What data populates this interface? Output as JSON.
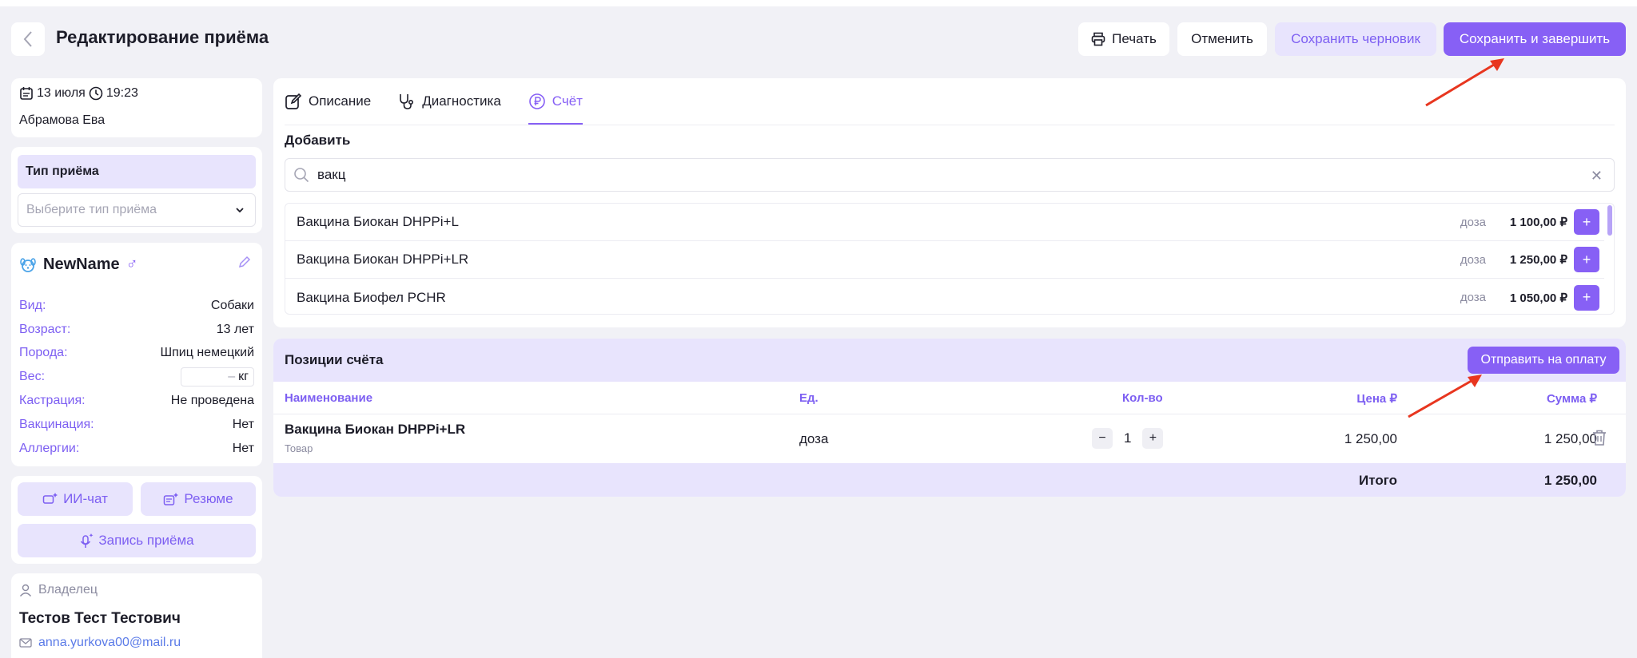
{
  "header": {
    "title": "Редактирование приёма",
    "print_label": "Печать",
    "cancel_label": "Отменить",
    "draft_label": "Сохранить черновик",
    "save_label": "Сохранить и завершить"
  },
  "visit": {
    "date": "13 июля",
    "time": "19:23",
    "doctor": "Абрамова Ева"
  },
  "visit_type": {
    "label": "Тип приёма",
    "placeholder": "Выберите тип приёма"
  },
  "pet": {
    "name": "NewName",
    "sex_symbol": "♂",
    "fields": [
      {
        "key": "Вид:",
        "value": "Собаки"
      },
      {
        "key": "Возраст:",
        "value": "13 лет"
      },
      {
        "key": "Порода:",
        "value": "Шпиц немецкий"
      },
      {
        "key": "Вес:",
        "value": "–",
        "unit": "кг"
      },
      {
        "key": "Кастрация:",
        "value": "Не проведена"
      },
      {
        "key": "Вакцинация:",
        "value": "Нет"
      },
      {
        "key": "Аллергии:",
        "value": "Нет"
      }
    ]
  },
  "ai": {
    "chat_label": "ИИ-чат",
    "resume_label": "Резюме",
    "record_label": "Запись приёма"
  },
  "owner": {
    "label": "Владелец",
    "name": "Тестов Тест Тестович",
    "email": "anna.yurkova00@mail.ru"
  },
  "tabs": [
    {
      "label": "Описание",
      "icon": "edit-icon"
    },
    {
      "label": "Диагностика",
      "icon": "stethoscope-icon"
    },
    {
      "label": "Счёт",
      "icon": "ruble-icon",
      "active": true
    }
  ],
  "add": {
    "label": "Добавить",
    "search_value": "вакц",
    "results": [
      {
        "name": "Вакцина Биокан DHPPi+L",
        "unit": "доза",
        "price": "1 100,00 ₽"
      },
      {
        "name": "Вакцина Биокан DHPPi+LR",
        "unit": "доза",
        "price": "1 250,00 ₽"
      },
      {
        "name": "Вакцина Биофел PCHR",
        "unit": "доза",
        "price": "1 050,00 ₽"
      }
    ]
  },
  "invoice": {
    "title": "Позиции счёта",
    "send_label": "Отправить на оплату",
    "columns": {
      "name": "Наименование",
      "unit": "Ед.",
      "qty": "Кол-во",
      "price": "Цена ₽",
      "sum": "Сумма ₽"
    },
    "rows": [
      {
        "name": "Вакцина Биокан DHPPi+LR",
        "type": "Товар",
        "unit": "доза",
        "qty": "1",
        "price": "1 250,00",
        "sum": "1 250,00"
      }
    ],
    "total_label": "Итого",
    "total_value": "1 250,00"
  },
  "colors": {
    "accent": "#8760f5",
    "accent_light": "#e8e4fd",
    "annotation_arrow": "#e8361f"
  }
}
